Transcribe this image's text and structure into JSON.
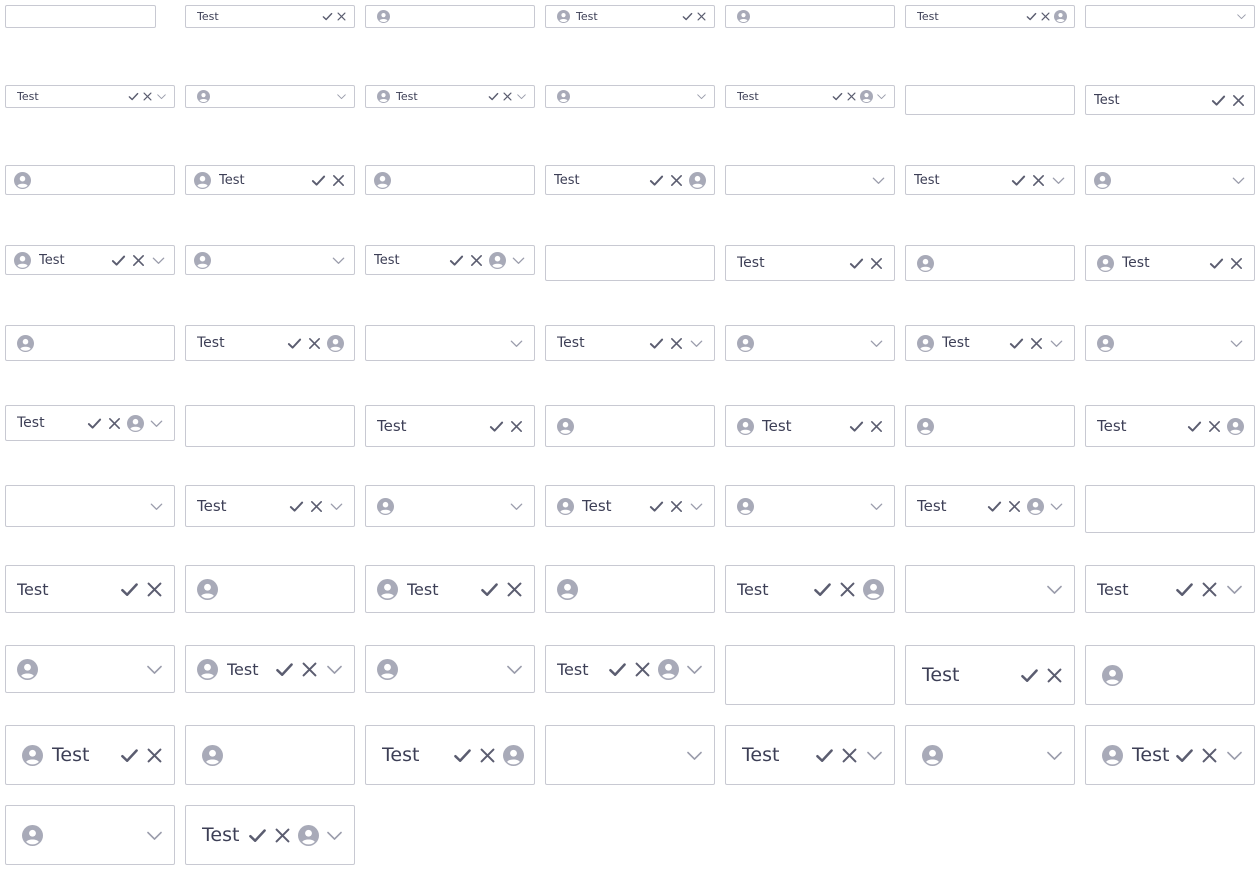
{
  "value_text": "Test",
  "colors": {
    "border": "#c8c9d2",
    "text": "#3d3f56",
    "check": "#5b5d70",
    "clear": "#5b5d70",
    "avatar": "#a8aab8",
    "chevron": "#9a9cab"
  },
  "icons": [
    "avatar-icon",
    "check-icon",
    "clear-icon",
    "chevron-down-icon"
  ],
  "fields": [
    {
      "has_value": false,
      "avatar": false,
      "dropdown": false
    },
    {
      "has_value": true,
      "avatar": false,
      "dropdown": false
    },
    {
      "has_value": false,
      "avatar": true,
      "dropdown": false
    },
    {
      "has_value": true,
      "avatar": true,
      "dropdown": false
    },
    {
      "has_value": false,
      "avatar": true,
      "dropdown": false
    },
    {
      "has_value": true,
      "avatar": true,
      "dropdown": false
    },
    {
      "has_value": false,
      "avatar": false,
      "dropdown": true
    },
    {
      "has_value": true,
      "avatar": false,
      "dropdown": true
    },
    {
      "has_value": false,
      "avatar": true,
      "dropdown": true
    },
    {
      "has_value": true,
      "avatar": true,
      "dropdown": true
    },
    {
      "has_value": false,
      "avatar": true,
      "dropdown": true
    },
    {
      "has_value": true,
      "avatar": true,
      "dropdown": true
    },
    {
      "has_value": false,
      "avatar": false,
      "dropdown": false
    },
    {
      "has_value": true,
      "avatar": false,
      "dropdown": false
    },
    {
      "has_value": false,
      "avatar": true,
      "dropdown": false
    },
    {
      "has_value": true,
      "avatar": true,
      "dropdown": false
    },
    {
      "has_value": false,
      "avatar": true,
      "dropdown": false
    },
    {
      "has_value": true,
      "avatar": true,
      "dropdown": false
    },
    {
      "has_value": false,
      "avatar": false,
      "dropdown": true
    },
    {
      "has_value": true,
      "avatar": false,
      "dropdown": true
    },
    {
      "has_value": false,
      "avatar": true,
      "dropdown": true
    },
    {
      "has_value": true,
      "avatar": true,
      "dropdown": true
    },
    {
      "has_value": false,
      "avatar": true,
      "dropdown": true
    },
    {
      "has_value": true,
      "avatar": true,
      "dropdown": true
    },
    {
      "has_value": false,
      "avatar": false,
      "dropdown": false
    },
    {
      "has_value": true,
      "avatar": false,
      "dropdown": false
    },
    {
      "has_value": false,
      "avatar": true,
      "dropdown": false
    },
    {
      "has_value": true,
      "avatar": true,
      "dropdown": false
    },
    {
      "has_value": false,
      "avatar": true,
      "dropdown": false
    },
    {
      "has_value": true,
      "avatar": true,
      "dropdown": false
    },
    {
      "has_value": false,
      "avatar": false,
      "dropdown": true
    },
    {
      "has_value": true,
      "avatar": false,
      "dropdown": true
    },
    {
      "has_value": false,
      "avatar": true,
      "dropdown": true
    },
    {
      "has_value": true,
      "avatar": true,
      "dropdown": true
    },
    {
      "has_value": false,
      "avatar": true,
      "dropdown": true
    },
    {
      "has_value": true,
      "avatar": true,
      "dropdown": true
    },
    {
      "has_value": false,
      "avatar": false,
      "dropdown": false
    },
    {
      "has_value": true,
      "avatar": false,
      "dropdown": false
    },
    {
      "has_value": false,
      "avatar": true,
      "dropdown": false
    },
    {
      "has_value": true,
      "avatar": true,
      "dropdown": false
    },
    {
      "has_value": false,
      "avatar": true,
      "dropdown": false
    },
    {
      "has_value": true,
      "avatar": true,
      "dropdown": false
    },
    {
      "has_value": false,
      "avatar": false,
      "dropdown": true
    },
    {
      "has_value": true,
      "avatar": false,
      "dropdown": true
    },
    {
      "has_value": false,
      "avatar": true,
      "dropdown": true
    },
    {
      "has_value": true,
      "avatar": true,
      "dropdown": true
    },
    {
      "has_value": false,
      "avatar": true,
      "dropdown": true
    },
    {
      "has_value": true,
      "avatar": true,
      "dropdown": true
    },
    {
      "has_value": false,
      "avatar": false,
      "dropdown": false
    },
    {
      "has_value": true,
      "avatar": false,
      "dropdown": false
    },
    {
      "has_value": false,
      "avatar": true,
      "dropdown": false
    },
    {
      "has_value": true,
      "avatar": true,
      "dropdown": false
    },
    {
      "has_value": false,
      "avatar": true,
      "dropdown": false
    },
    {
      "has_value": true,
      "avatar": true,
      "dropdown": false
    },
    {
      "has_value": false,
      "avatar": false,
      "dropdown": true
    },
    {
      "has_value": true,
      "avatar": false,
      "dropdown": true
    },
    {
      "has_value": false,
      "avatar": true,
      "dropdown": true
    },
    {
      "has_value": true,
      "avatar": true,
      "dropdown": true
    },
    {
      "has_value": false,
      "avatar": true,
      "dropdown": true
    },
    {
      "has_value": true,
      "avatar": true,
      "dropdown": true
    },
    {
      "has_value": false,
      "avatar": false,
      "dropdown": false
    },
    {
      "has_value": true,
      "avatar": false,
      "dropdown": false
    },
    {
      "has_value": false,
      "avatar": true,
      "dropdown": false
    },
    {
      "has_value": true,
      "avatar": true,
      "dropdown": false
    },
    {
      "has_value": false,
      "avatar": true,
      "dropdown": false
    },
    {
      "has_value": true,
      "avatar": true,
      "dropdown": false
    },
    {
      "has_value": false,
      "avatar": false,
      "dropdown": true
    },
    {
      "has_value": true,
      "avatar": false,
      "dropdown": true
    },
    {
      "has_value": false,
      "avatar": true,
      "dropdown": true
    },
    {
      "has_value": true,
      "avatar": true,
      "dropdown": true
    },
    {
      "has_value": false,
      "avatar": true,
      "dropdown": true
    },
    {
      "has_value": true,
      "avatar": true,
      "dropdown": true
    }
  ]
}
